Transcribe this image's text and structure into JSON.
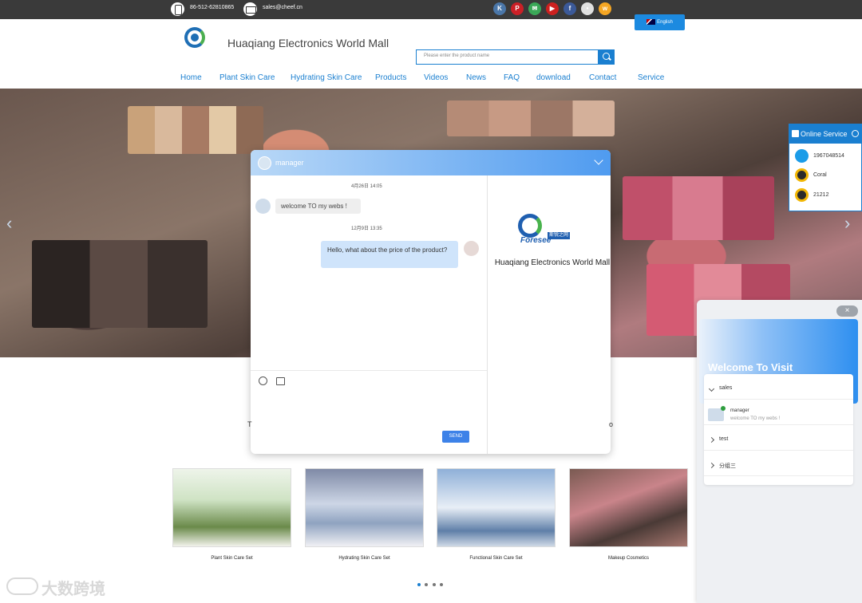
{
  "topbar": {
    "phone": "86-512-62810865",
    "email": "sales@cheef.cn",
    "language": "English"
  },
  "social_icons": [
    {
      "name": "vk-icon",
      "color": "#4a76a8",
      "glyph": "K"
    },
    {
      "name": "pinterest-icon",
      "color": "#cb2027",
      "glyph": "P"
    },
    {
      "name": "email-share-icon",
      "color": "#3aa757",
      "glyph": "✉"
    },
    {
      "name": "youtube-icon",
      "color": "#cd201f",
      "glyph": "▶"
    },
    {
      "name": "facebook-icon",
      "color": "#3b5998",
      "glyph": "f"
    },
    {
      "name": "share-icon",
      "color": "#e0e0e0",
      "glyph": "•"
    },
    {
      "name": "weibo-icon",
      "color": "#f5a623",
      "glyph": "w"
    }
  ],
  "header": {
    "site_title": "Huaqiang Electronics World Mall",
    "search_placeholder": "Please enter the product name"
  },
  "nav": [
    "Home",
    "Plant Skin Care",
    "Hydrating Skin Care",
    "Products",
    "Videos",
    "News",
    "FAQ",
    "download",
    "Contact",
    "Service"
  ],
  "chat": {
    "agent_name": "manager",
    "messages": [
      {
        "time": "4月26日 14:05",
        "from": "agent",
        "text": "welcome TO my webs !"
      },
      {
        "time": "12月9日 13:35",
        "from": "user",
        "text": "Hello, what about the price of the product?"
      }
    ],
    "send_label": "SEND",
    "brand_badge": "斯锐之网",
    "brand_logo_text": "Foresee",
    "brand_name": "Huaqiang Electronics World Mall"
  },
  "online_service": {
    "title": "Online Service",
    "contacts": [
      {
        "type": "skype",
        "label": "1967048514",
        "color": "#1b9ce8"
      },
      {
        "type": "qq",
        "label": "Coral",
        "color": "#f2b705"
      },
      {
        "type": "qq",
        "label": "21212",
        "color": "#f2b705"
      }
    ]
  },
  "welcome": {
    "title": "Welcome To Visit",
    "close": "×",
    "groups": [
      {
        "name": "sales",
        "expanded": true
      },
      {
        "name": "test",
        "expanded": false
      },
      {
        "name": "分组三",
        "expanded": false
      }
    ],
    "member": {
      "name": "manager",
      "last_message": "welcome TO my webs !"
    }
  },
  "section_fragments": {
    "left": "T",
    "right": "o"
  },
  "products": [
    {
      "label": "Plant Skin Care Set",
      "palette": [
        "#cfe3c4",
        "#6a8a4a",
        "#f2f2ec"
      ]
    },
    {
      "label": "Hydrating Skin Care Set",
      "palette": [
        "#cdd6e6",
        "#8fa3c0",
        "#f0f0f4"
      ]
    },
    {
      "label": "Functional Skin Care Set",
      "palette": [
        "#8fb0d8",
        "#e8eef6",
        "#5f7fa8"
      ]
    },
    {
      "label": "Makeup Cosmetics",
      "palette": [
        "#7a5a52",
        "#c9848a",
        "#4a3a36"
      ]
    }
  ],
  "watermark": "大数跨境"
}
